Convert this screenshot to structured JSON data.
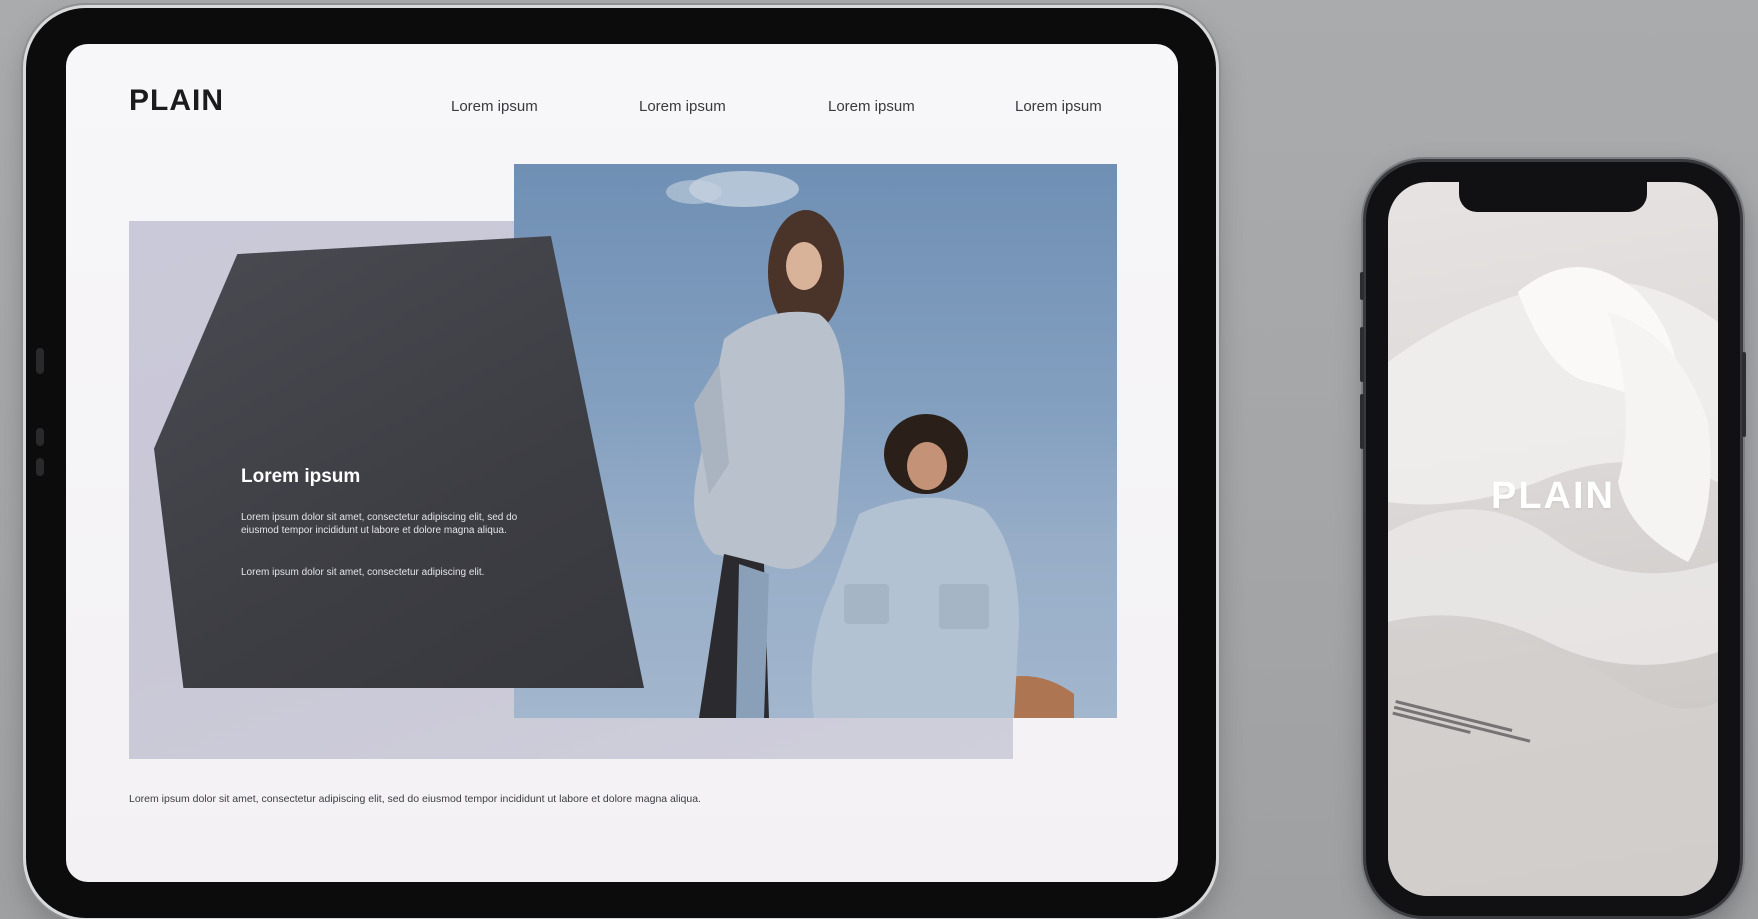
{
  "tablet": {
    "brand": "PLAIN",
    "nav": [
      {
        "label": "Lorem ipsum"
      },
      {
        "label": "Lorem ipsum"
      },
      {
        "label": "Lorem ipsum"
      },
      {
        "label": "Lorem ipsum"
      }
    ],
    "panel": {
      "title": "Lorem ipsum",
      "body": "Lorem ipsum dolor sit amet, consectetur adipiscing elit, sed do eiusmod tempor incididunt ut labore et dolore magna aliqua.",
      "body2": "Lorem ipsum dolor sit amet, consectetur adipiscing elit."
    },
    "caption": "Lorem ipsum dolor sit amet, consectetur adipiscing elit, sed do eiusmod tempor incididunt ut labore et dolore magna aliqua."
  },
  "phone": {
    "brand": "PLAIN"
  },
  "colors": {
    "background": "#a9abad",
    "device_frame": "#0c0c0d",
    "tablet_screen": "#f5f3f5",
    "lavender_block": "#cac9d9",
    "dark_panel": "#414248",
    "sky": "#7f9bbd"
  }
}
